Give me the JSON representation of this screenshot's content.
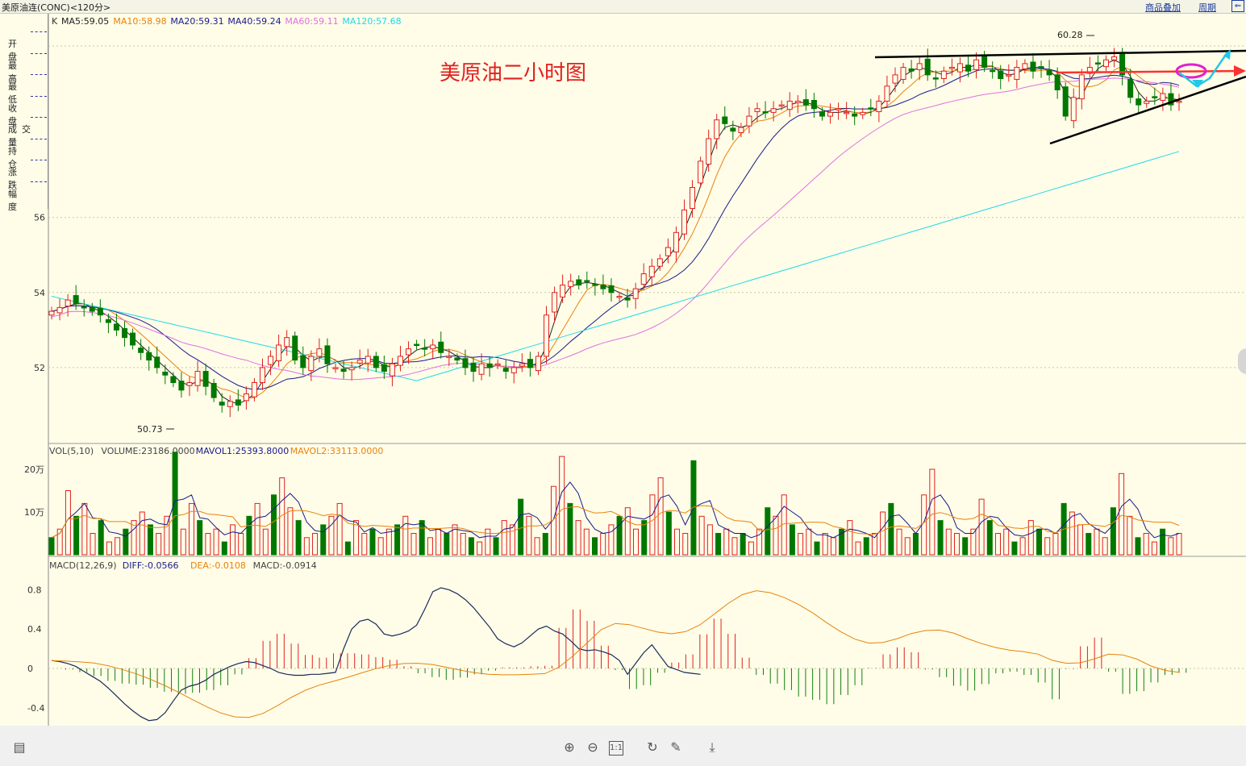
{
  "window": {
    "title": "美原油连(CONC)<120分>",
    "link_overlay": "商品叠加",
    "link_period": "周期"
  },
  "chart_title": "美原油二小时图",
  "side_labels": [
    "开 盘",
    "最 高",
    "最 低",
    "收 盘",
    "成交量",
    "持 仓",
    "涨 跌",
    "幅 度"
  ],
  "ma_legend": {
    "k": "K",
    "items": [
      {
        "label": "MA5:59.05",
        "color": "#222222"
      },
      {
        "label": "MA10:58.98",
        "color": "#e8820c"
      },
      {
        "label": "MA20:59.31",
        "color": "#1a1a8c"
      },
      {
        "label": "MA40:59.24",
        "color": "#1a1a8c"
      },
      {
        "label": "MA60:59.11",
        "color": "#e070e0"
      },
      {
        "label": "MA120:57.68",
        "color": "#20d8e8"
      }
    ]
  },
  "price_axis": {
    "ticks": [
      "56",
      "54",
      "52"
    ]
  },
  "annotations": {
    "high": "60.28",
    "low": "50.73"
  },
  "vol_legend": {
    "items": [
      {
        "label": "VOL(5,10)",
        "color": "#444444"
      },
      {
        "label": "VOLUME:23186.0000",
        "color": "#444444"
      },
      {
        "label": "MAVOL1:25393.8000",
        "color": "#1a1a8c"
      },
      {
        "label": "MAVOL2:33113.0000",
        "color": "#e8820c"
      }
    ]
  },
  "vol_axis": {
    "ticks": [
      "20万",
      "10万"
    ]
  },
  "macd_legend": {
    "items": [
      {
        "label": "MACD(12,26,9)",
        "color": "#444444"
      },
      {
        "label": "DIFF:-0.0566",
        "color": "#1a1a8c"
      },
      {
        "label": "DEA:-0.0108",
        "color": "#e8820c"
      },
      {
        "label": "MACD:-0.0914",
        "color": "#444444"
      }
    ]
  },
  "macd_axis": {
    "ticks": [
      "0.8",
      "0.4",
      "0",
      "-0.4"
    ]
  },
  "colors": {
    "up": "#e02020",
    "down": "#007800",
    "ma5": "#222222",
    "ma10": "#e8820c",
    "ma20": "#1a1a8c",
    "ma60": "#e070e0",
    "ma120": "#20d8e8",
    "background": "#fffde8"
  },
  "toolbar_icons": [
    "layout-icon",
    "zoom-in-icon",
    "zoom-out-icon",
    "reset-icon",
    "rotate-icon",
    "pen-icon",
    "download-icon"
  ],
  "chart_data": {
    "type": "candlestick",
    "title": "美原油二小时图",
    "ylim": [
      50.3,
      61.0
    ],
    "close_path": [
      53.5,
      53.6,
      53.8,
      53.7,
      53.6,
      53.5,
      53.4,
      53.2,
      53.0,
      52.8,
      52.6,
      52.4,
      52.2,
      52.0,
      51.8,
      51.6,
      51.4,
      51.6,
      51.9,
      51.5,
      51.2,
      51.0,
      51.1,
      51.0,
      51.3,
      51.6,
      52.0,
      52.3,
      52.6,
      52.8,
      52.2,
      52.0,
      52.3,
      52.5,
      52.1,
      52.0,
      51.9,
      52.0,
      52.2,
      52.3,
      52.0,
      51.9,
      52.1,
      52.3,
      52.5,
      52.6,
      52.5,
      52.6,
      52.4,
      52.3,
      52.2,
      52.0,
      51.9,
      52.1,
      52.0,
      52.1,
      51.9,
      52.0,
      52.1,
      52.0,
      52.3,
      53.4,
      54.0,
      54.2,
      54.3,
      54.2,
      54.3,
      54.2,
      54.1,
      54.0,
      53.9,
      53.8,
      54.1,
      54.5,
      54.7,
      54.9,
      55.2,
      55.6,
      56.2,
      56.8,
      57.5,
      58.1,
      58.6,
      58.5,
      58.3,
      58.4,
      58.7,
      58.9,
      58.8,
      58.9,
      59.0,
      59.1,
      59.1,
      59.0,
      58.9,
      58.7,
      58.8,
      58.9,
      58.8,
      58.7,
      58.8,
      58.9,
      59.1,
      59.5,
      59.8,
      60.0,
      59.9,
      60.1,
      59.8,
      59.7,
      59.9,
      60.0,
      60.1,
      59.9,
      60.2,
      60.0,
      59.9,
      59.7,
      59.8,
      60.0,
      60.1,
      59.9,
      60.0,
      59.8,
      59.4,
      58.7,
      59.2,
      59.8,
      60.0,
      60.1,
      60.2,
      60.28,
      59.8,
      59.2,
      59.0,
      59.1,
      59.2,
      59.3,
      59.0,
      59.1
    ],
    "vol_path": [
      4,
      6,
      15,
      9,
      12,
      5,
      8,
      3,
      4,
      6,
      8,
      10,
      7,
      5,
      9,
      24,
      6,
      12,
      8,
      5,
      6,
      3,
      7,
      5,
      9,
      12,
      6,
      14,
      18,
      11,
      8,
      4,
      5,
      7,
      9,
      12,
      3,
      8,
      5,
      6,
      4,
      6,
      7,
      9,
      5,
      8,
      4,
      6,
      5,
      7,
      5,
      4,
      3,
      6,
      4,
      8,
      7,
      13,
      9,
      4,
      5,
      16,
      23,
      12,
      8,
      6,
      4,
      5,
      7,
      9,
      11,
      6,
      8,
      14,
      18,
      10,
      6,
      5,
      22,
      9,
      7,
      5,
      6,
      4,
      5,
      3,
      6,
      11,
      9,
      14,
      7,
      5,
      6,
      3,
      5,
      4,
      6,
      8,
      3,
      4,
      5,
      10,
      12,
      6,
      4,
      5,
      14,
      20,
      8,
      6,
      5,
      4,
      6,
      13,
      8,
      5,
      6,
      3,
      4,
      8,
      6,
      4,
      5,
      12,
      10,
      7,
      5,
      6,
      4,
      11,
      19,
      9,
      4,
      5,
      3,
      6,
      4,
      5
    ],
    "macd_diff_path": [
      0.08,
      0.07,
      0.05,
      0.02,
      -0.03,
      -0.08,
      -0.13,
      -0.2,
      -0.28,
      -0.36,
      -0.43,
      -0.49,
      -0.53,
      -0.52,
      -0.45,
      -0.33,
      -0.22,
      -0.18,
      -0.16,
      -0.12,
      -0.06,
      -0.02,
      0.02,
      0.05,
      0.07,
      0.06,
      0.03,
      0.0,
      -0.04,
      -0.06,
      -0.07,
      -0.07,
      -0.06,
      -0.06,
      -0.05,
      -0.04,
      0.2,
      0.4,
      0.48,
      0.5,
      0.45,
      0.35,
      0.33,
      0.35,
      0.38,
      0.44,
      0.6,
      0.78,
      0.82,
      0.8,
      0.76,
      0.7,
      0.62,
      0.52,
      0.42,
      0.3,
      0.25,
      0.22,
      0.26,
      0.33,
      0.4,
      0.43,
      0.38,
      0.35,
      0.28,
      0.2,
      0.18,
      0.19,
      0.17,
      0.14,
      0.08,
      -0.06,
      0.05,
      0.16,
      0.24,
      0.13,
      0.02,
      -0.01,
      -0.04,
      -0.05,
      -0.06
    ]
  }
}
